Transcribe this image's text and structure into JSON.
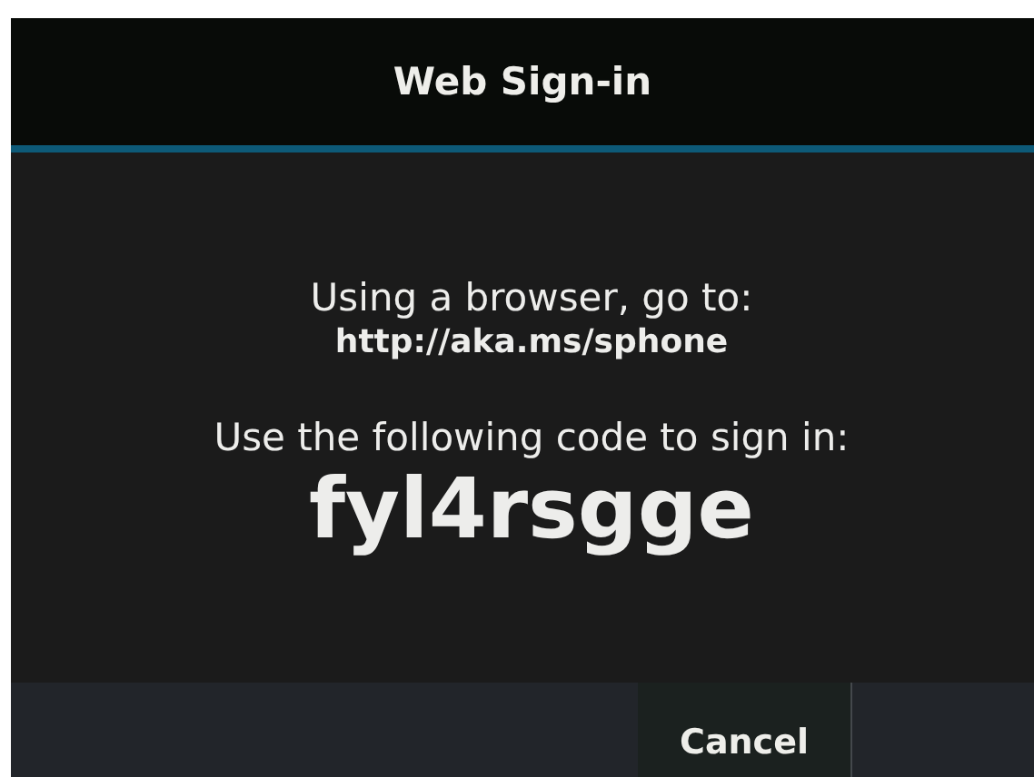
{
  "window": {
    "title": "Web Sign-in"
  },
  "instructions": [
    {
      "text": "Using a browser, go to:",
      "kind": "plain"
    },
    {
      "text": "http://aka.ms/sphone",
      "kind": "link"
    },
    {
      "text": "Use the following code to sign in:",
      "kind": "plain"
    },
    {
      "text": "fyl4rsgge",
      "kind": "code"
    }
  ],
  "buttons": [
    {
      "label": "Cancel"
    }
  ]
}
